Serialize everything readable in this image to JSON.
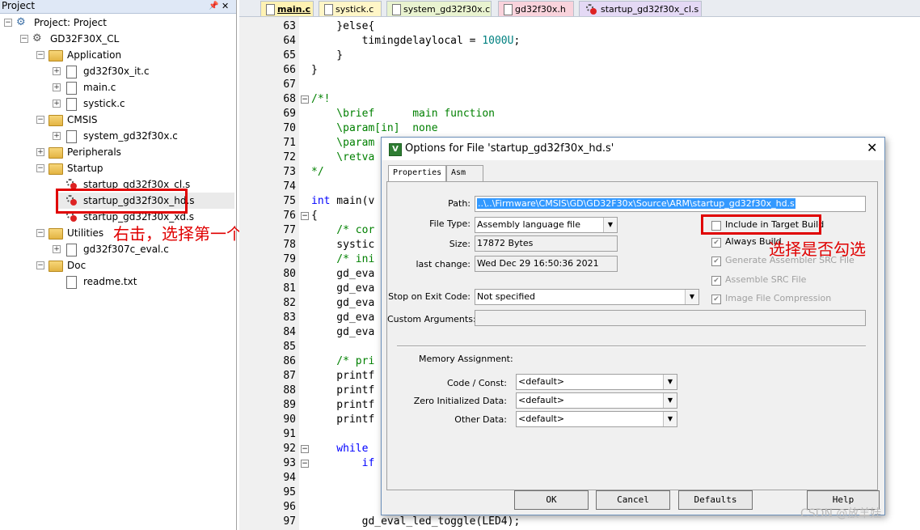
{
  "project": {
    "title": "Project",
    "root": "Project: Project",
    "target": "GD32F30X_CL",
    "groups": {
      "application": "Application",
      "cmsis": "CMSIS",
      "peripherals": "Peripherals",
      "startup": "Startup",
      "utilities": "Utilities",
      "doc": "Doc"
    },
    "files": {
      "it": "gd32f30x_it.c",
      "main": "main.c",
      "systick": "systick.c",
      "system": "system_gd32f30x.c",
      "startup_cl": "startup_gd32f30x_cl.s",
      "startup_hd": "startup_gd32f30x_hd.s",
      "startup_xd": "startup_gd32f30x_xd.s",
      "eval": "gd32f307c_eval.c",
      "readme": "readme.txt"
    }
  },
  "annotations": {
    "right_click": "右击，选择第一个",
    "choose_check": "选择是否勾选"
  },
  "tabs": [
    "main.c",
    "systick.c",
    "system_gd32f30x.c",
    "gd32f30x.h",
    "startup_gd32f30x_cl.s"
  ],
  "tab_colors": [
    "#fff2b3",
    "#fff6c7",
    "#e9f3d0",
    "#f9d3dc",
    "#e4d9f5"
  ],
  "code": {
    "line_numbers": [
      "63",
      "64",
      "65",
      "66",
      "67",
      "68",
      "69",
      "70",
      "71",
      "72",
      "73",
      "74",
      "75",
      "76",
      "77",
      "78",
      "79",
      "80",
      "81",
      "82",
      "83",
      "84",
      "85",
      "86",
      "87",
      "88",
      "89",
      "90",
      "91",
      "92",
      "93",
      "94",
      "95",
      "96",
      "97"
    ],
    "l63": "    }else{",
    "l64a": "        timingdelaylocal = ",
    "l64b": "1000U",
    "l64c": ";",
    "l65": "    }",
    "l66": "}",
    "l68": "/*!",
    "l69": "    \\brief      main function",
    "l70": "    \\param[in]  none",
    "l71": "    \\param",
    "l72": "    \\retva",
    "l73": "*/",
    "l75a": "int",
    "l75b": " main(v",
    "l76": "{",
    "l77": "    /* cor",
    "l78": "    systic",
    "l79": "    /* ini",
    "l80": "    gd_eva",
    "l81": "    gd_eva",
    "l82": "    gd_eva",
    "l83": "    gd_eva",
    "l84": "    gd_eva",
    "l86": "    /* pri",
    "l87": "    printf",
    "l88": "    printf",
    "l89": "    printf",
    "l90": "    printf",
    "l92": "    while",
    "l93": "        if",
    "l97": "        gd_eval_led_toggle(LED4);"
  },
  "dialog": {
    "title": "Options for File 'startup_gd32f30x_hd.s'",
    "close": "✕",
    "tabs": [
      "Properties",
      "Asm"
    ],
    "path_label": "Path:",
    "path_value": "..\\..\\Firmware\\CMSIS\\GD\\GD32F30x\\Source\\ARM\\startup_gd32f30x_hd.s",
    "file_type_label": "File Type:",
    "file_type_value": "Assembly language file",
    "size_label": "Size:",
    "size_value": "17872 Bytes",
    "last_change_label": "last change:",
    "last_change_value": "Wed Dec 29 16:50:36 2021",
    "stop_label": "Stop on Exit Code:",
    "stop_value": "Not specified",
    "custom_label": "Custom Arguments:",
    "custom_value": "",
    "include_label": "Include in Target Build",
    "include_checked": false,
    "always_build_label": "Always Build",
    "gen_src_label": "Generate Assembler SRC File",
    "asm_src_label": "Assemble SRC File",
    "image_comp_label": "Image File Compression",
    "memory_label": "Memory Assignment:",
    "code_const_label": "Code / Const:",
    "zero_init_label": "Zero Initialized Data:",
    "other_label": "Other Data:",
    "default_value": "<default>",
    "ok": "OK",
    "cancel": "Cancel",
    "defaults": "Defaults",
    "help": "Help"
  },
  "watermark": "CSDN @放羊娃"
}
